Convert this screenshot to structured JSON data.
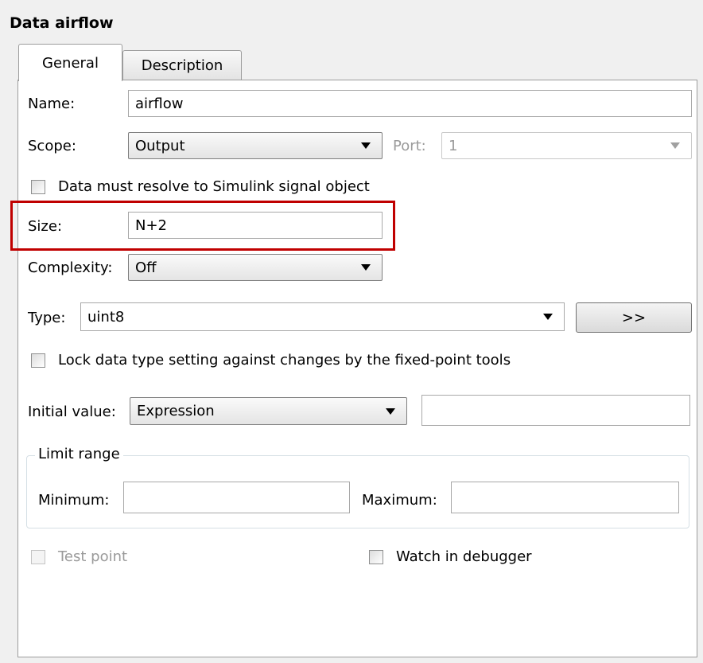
{
  "title": "Data airflow",
  "tabs": [
    {
      "label": "General",
      "active": true
    },
    {
      "label": "Description",
      "active": false
    }
  ],
  "name": {
    "label": "Name:",
    "value": "airflow"
  },
  "scope": {
    "label": "Scope:",
    "value": "Output"
  },
  "port": {
    "label": "Port:",
    "value": "1"
  },
  "resolve_checkbox": {
    "label": "Data must resolve to Simulink signal object",
    "checked": false
  },
  "size": {
    "label": "Size:",
    "value": "N+2"
  },
  "complexity": {
    "label": "Complexity:",
    "value": "Off"
  },
  "type": {
    "label": "Type:",
    "value": "uint8",
    "assistant_button": ">>"
  },
  "lock_checkbox": {
    "label": "Lock data type setting against changes by the fixed-point tools",
    "checked": false
  },
  "initial_value": {
    "label": "Initial value:",
    "mode": "Expression",
    "value": ""
  },
  "limit_range": {
    "legend": "Limit range",
    "minimum_label": "Minimum:",
    "minimum_value": "",
    "maximum_label": "Maximum:",
    "maximum_value": ""
  },
  "test_point": {
    "label": "Test point",
    "checked": false
  },
  "watch_debugger": {
    "label": "Watch in debugger",
    "checked": false
  },
  "colors": {
    "highlight": "#c00000",
    "panel_bg": "#ffffff",
    "window_bg": "#f0f0f0"
  }
}
